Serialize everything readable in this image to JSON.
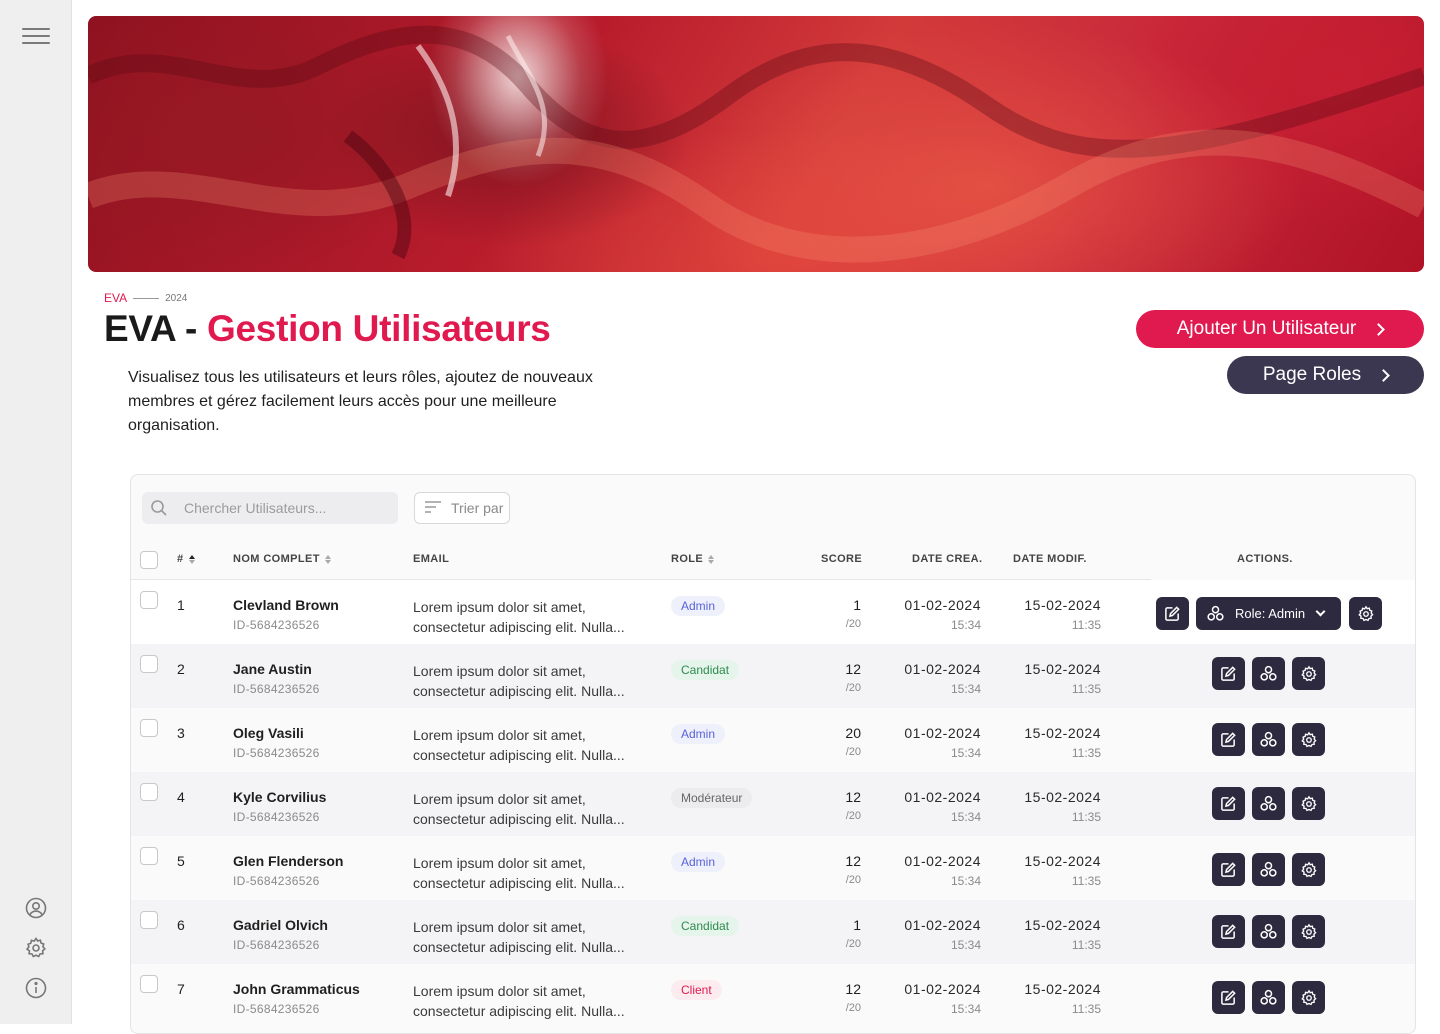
{
  "sidebar": {
    "icons": [
      "menu-icon",
      "user-icon",
      "gear-icon",
      "info-icon"
    ]
  },
  "header": {
    "eyebrow_brand": "EVA",
    "eyebrow_year": "2024",
    "title_prefix": "EVA - ",
    "title_accent": "Gestion Utilisateurs",
    "description": "Visualisez tous les utilisateurs et leurs rôles, ajoutez de nouveaux membres et gérez facilement leurs accès pour une meilleure organisation.",
    "add_user_label": "Ajouter Un Utilisateur",
    "roles_page_label": "Page Roles"
  },
  "colors": {
    "accent": "#e0194f",
    "dark": "#2d2a40",
    "dark_button": "#3b3750"
  },
  "toolbar": {
    "search_placeholder": "Chercher Utilisateurs...",
    "sort_label": "Trier par"
  },
  "table": {
    "columns": {
      "index": "#",
      "name": "NOM COMPLET",
      "email": "EMAIL",
      "role": "ROLE",
      "score": "SCORE",
      "created": "DATE CREA.",
      "modified": "DATE MODIF.",
      "actions": "ACTIONS."
    },
    "rows": [
      {
        "num": "1",
        "name": "Clevland Brown",
        "id": "ID-5684236526",
        "email_l1": "Lorem ipsum dolor sit amet,",
        "email_l2": "consectetur adipiscing elit. Nulla...",
        "role": "Admin",
        "role_kind": "admin",
        "score": "1",
        "score_max": "/20",
        "created_date": "01-02-2024",
        "created_time": "15:34",
        "modified_date": "15-02-2024",
        "modified_time": "11:35"
      },
      {
        "num": "2",
        "name": "Jane Austin",
        "id": "ID-5684236526",
        "email_l1": "Lorem ipsum dolor sit amet,",
        "email_l2": "consectetur adipiscing elit. Nulla...",
        "role": "Candidat",
        "role_kind": "candidat",
        "score": "12",
        "score_max": "/20",
        "created_date": "01-02-2024",
        "created_time": "15:34",
        "modified_date": "15-02-2024",
        "modified_time": "11:35"
      },
      {
        "num": "3",
        "name": "Oleg Vasili",
        "id": "ID-5684236526",
        "email_l1": "Lorem ipsum dolor sit amet,",
        "email_l2": "consectetur adipiscing elit. Nulla...",
        "role": "Admin",
        "role_kind": "admin",
        "score": "20",
        "score_max": "/20",
        "created_date": "01-02-2024",
        "created_time": "15:34",
        "modified_date": "15-02-2024",
        "modified_time": "11:35"
      },
      {
        "num": "4",
        "name": "Kyle Corvilius",
        "id": "ID-5684236526",
        "email_l1": "Lorem ipsum dolor sit amet,",
        "email_l2": "consectetur adipiscing elit. Nulla...",
        "role": "Modérateur",
        "role_kind": "moderateur",
        "score": "12",
        "score_max": "/20",
        "created_date": "01-02-2024",
        "created_time": "15:34",
        "modified_date": "15-02-2024",
        "modified_time": "11:35"
      },
      {
        "num": "5",
        "name": "Glen Flenderson",
        "id": "ID-5684236526",
        "email_l1": "Lorem ipsum dolor sit amet,",
        "email_l2": "consectetur adipiscing elit. Nulla...",
        "role": "Admin",
        "role_kind": "admin",
        "score": "12",
        "score_max": "/20",
        "created_date": "01-02-2024",
        "created_time": "15:34",
        "modified_date": "15-02-2024",
        "modified_time": "11:35"
      },
      {
        "num": "6",
        "name": "Gadriel Olvich",
        "id": "ID-5684236526",
        "email_l1": "Lorem ipsum dolor sit amet,",
        "email_l2": "consectetur adipiscing elit. Nulla...",
        "role": "Candidat",
        "role_kind": "candidat",
        "score": "1",
        "score_max": "/20",
        "created_date": "01-02-2024",
        "created_time": "15:34",
        "modified_date": "15-02-2024",
        "modified_time": "11:35"
      },
      {
        "num": "7",
        "name": "John Grammaticus",
        "id": "ID-5684236526",
        "email_l1": "Lorem ipsum dolor sit amet,",
        "email_l2": "consectetur adipiscing elit. Nulla...",
        "role": "Client",
        "role_kind": "client",
        "score": "12",
        "score_max": "/20",
        "created_date": "01-02-2024",
        "created_time": "15:34",
        "modified_date": "15-02-2024",
        "modified_time": "11:35"
      }
    ],
    "expanded_role_select": "Role: Admin"
  }
}
